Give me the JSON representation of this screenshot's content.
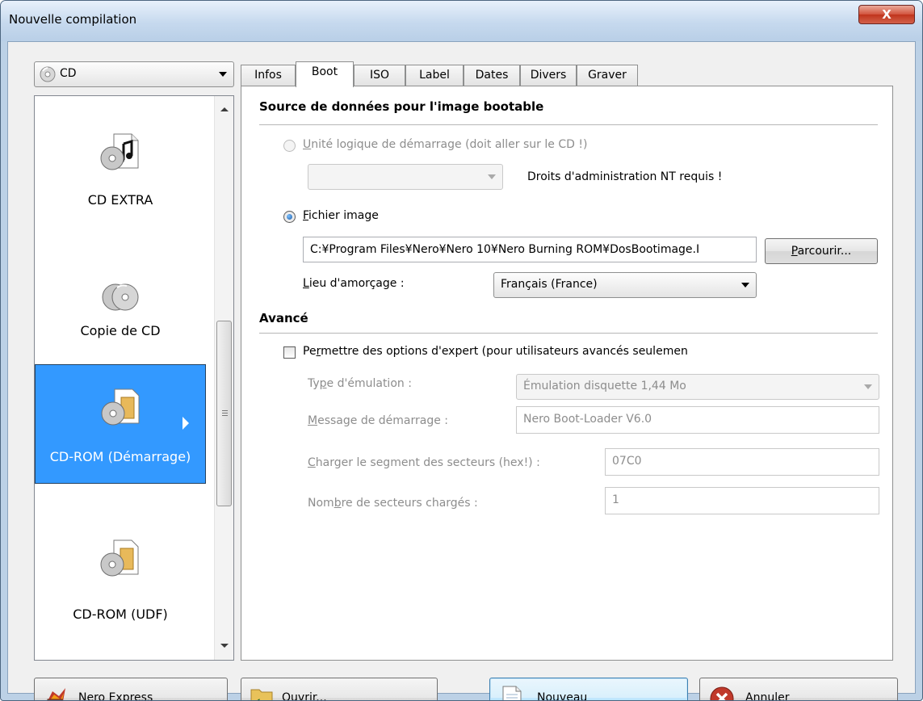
{
  "window": {
    "title": "Nouvelle compilation",
    "close_label": "X"
  },
  "media_select": {
    "value": "CD"
  },
  "categories": [
    {
      "label": "CD EXTRA",
      "icon": "cd-music-icon"
    },
    {
      "label": "Copie de CD",
      "icon": "cd-copy-icon"
    },
    {
      "label": "CD-ROM (Démarrage)",
      "icon": "cd-rom-boot-icon",
      "selected": true
    },
    {
      "label": "CD-ROM (UDF)",
      "icon": "cd-rom-udf-icon"
    }
  ],
  "tabs": [
    {
      "label": "Infos"
    },
    {
      "label": "Boot",
      "active": true
    },
    {
      "label": "ISO"
    },
    {
      "label": "Label"
    },
    {
      "label": "Dates"
    },
    {
      "label": "Divers"
    },
    {
      "label": "Graver"
    }
  ],
  "boot": {
    "source_title": "Source de données pour l'image bootable",
    "logical_drive_prefix": "U",
    "logical_drive_label": "nité logique de démarrage (doit aller sur le CD !)",
    "nt_admin_note": "Droits d'administration NT requis !",
    "image_file_prefix": "F",
    "image_file_label": "ichier image",
    "image_path": "C:¥Program Files¥Nero¥Nero 10¥Nero Burning ROM¥DosBootimage.I",
    "browse_prefix": "P",
    "browse_label": "arcourir...",
    "boot_locale_prefix": "L",
    "boot_locale_label": "ieu d'amorçage :",
    "boot_locale_value": "Français (France)",
    "advanced_title": "Avancé",
    "expert_prefix": "Pe",
    "expert_u": "r",
    "expert_label": "mettre des options d'expert (pour utilisateurs avancés seulemen",
    "emulation_prefix": "Ty",
    "emulation_u": "p",
    "emulation_label": "e d'émulation :",
    "emulation_value": "Émulation disquette 1,44 Mo",
    "boot_msg_u": "M",
    "boot_msg_label": "essage de démarrage :",
    "boot_msg_value": "Nero Boot-Loader V6.0",
    "load_segment_u": "C",
    "load_segment_label": "harger le segment des secteurs (hex!) :",
    "load_segment_value": "07C0",
    "sector_count_prefix": "Nom",
    "sector_count_u": "b",
    "sector_count_label": "re de secteurs chargés :",
    "sector_count_value": "1"
  },
  "footer": {
    "nero_express_prefix": "Nero ",
    "nero_express_u": "E",
    "nero_express_label": "xpress",
    "open_u": "O",
    "open_label": "uvrir...",
    "new_u": "N",
    "new_label": "ouveau",
    "cancel_u": "A",
    "cancel_label": "nnuler"
  }
}
